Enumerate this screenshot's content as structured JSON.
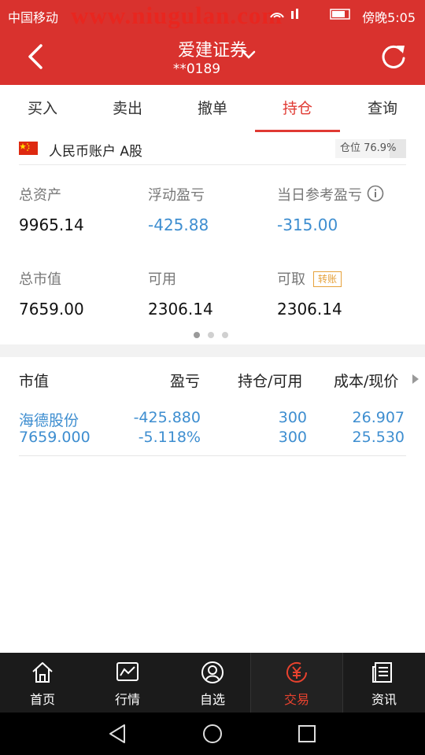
{
  "status_bar": {
    "carrier": "中国移动",
    "watermark": "www.niugulan.com",
    "time": "傍晚5:05"
  },
  "header": {
    "title": "爱建证券",
    "subtitle": "**0189"
  },
  "tabs": [
    "买入",
    "卖出",
    "撤单",
    "持仓",
    "查询"
  ],
  "active_tab": "持仓",
  "account": {
    "label": "人民币账户 A股",
    "position_text": "仓位 76.9%",
    "position_level": 0.769
  },
  "summary": {
    "total_assets": {
      "label": "总资产",
      "value": "9965.14"
    },
    "floating_pl": {
      "label": "浮动盈亏",
      "value": "-425.88"
    },
    "daily_pl": {
      "label": "当日参考盈亏",
      "value": "-315.00"
    },
    "market_value": {
      "label": "总市值",
      "value": "7659.00"
    },
    "available": {
      "label": "可用",
      "value": "2306.14"
    },
    "withdrawable": {
      "label": "可取",
      "value": "2306.14",
      "badge": "转账"
    }
  },
  "pager": {
    "pages": 3,
    "current": 1
  },
  "table": {
    "headers": [
      "市值",
      "盈亏",
      "持仓/可用",
      "成本/现价"
    ],
    "rows": [
      {
        "name": "海德股份",
        "market_value": "7659.000",
        "pl": "-425.880",
        "pl_pct": "-5.118%",
        "holding": "300",
        "available": "300",
        "cost": "26.907",
        "price": "25.530"
      }
    ]
  },
  "bottom_nav": [
    {
      "label": "首页",
      "icon": "home-icon"
    },
    {
      "label": "行情",
      "icon": "chart-icon"
    },
    {
      "label": "自选",
      "icon": "user-icon"
    },
    {
      "label": "交易",
      "icon": "yuan-icon"
    },
    {
      "label": "资讯",
      "icon": "news-icon"
    }
  ],
  "colors": {
    "brand_red": "#d9322e",
    "active_red": "#e03a33",
    "value_blue": "#3e8ed0",
    "badge_orange": "#e6a23c"
  }
}
